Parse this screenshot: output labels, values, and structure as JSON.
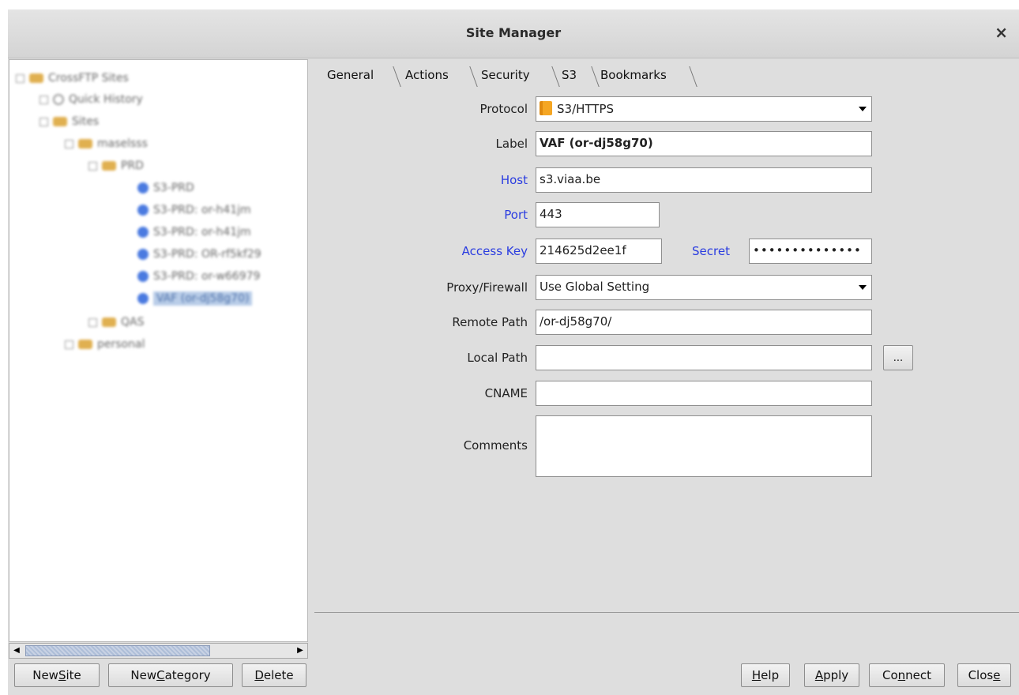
{
  "window": {
    "title": "Site Manager",
    "close_glyph": "×"
  },
  "tree": {
    "nodes": [
      {
        "label": "CrossFTP Sites",
        "icon": "folder-icon"
      },
      {
        "label": "Quick History",
        "icon": "clock-icon"
      },
      {
        "label": "Sites",
        "icon": "folder-icon"
      },
      {
        "label": "maselsss",
        "icon": "folder-icon"
      },
      {
        "label": "PRD",
        "icon": "folder-icon"
      },
      {
        "label": "S3-PRD",
        "icon": "globe-icon"
      },
      {
        "label": "S3-PRD: or-h41jm",
        "icon": "globe-icon"
      },
      {
        "label": "S3-PRD: or-h41jm",
        "icon": "globe-icon"
      },
      {
        "label": "S3-PRD: OR-rf5kf29",
        "icon": "globe-icon"
      },
      {
        "label": "S3-PRD: or-w66979",
        "icon": "globe-icon"
      },
      {
        "label": "VAF (or-dj58g70)",
        "icon": "globe-icon",
        "selected": true
      },
      {
        "label": "QAS",
        "icon": "folder-icon"
      },
      {
        "label": "personal",
        "icon": "folder-icon"
      }
    ]
  },
  "left_buttons": {
    "new_site": {
      "pre": "New ",
      "u": "S",
      "post": "ite"
    },
    "new_category": {
      "pre": "New ",
      "u": "C",
      "post": "ategory"
    },
    "delete": {
      "pre": "",
      "u": "D",
      "post": "elete"
    }
  },
  "tabs": [
    "General",
    "Actions",
    "Security",
    "S3",
    "Bookmarks"
  ],
  "form": {
    "protocol_label": "Protocol",
    "protocol_value": "S3/HTTPS",
    "label_label": "Label",
    "label_value": "VAF (or-dj58g70)",
    "host_label": "Host",
    "host_value": "s3.viaa.be",
    "port_label": "Port",
    "port_value": "443",
    "access_key_label": "Access Key",
    "access_key_value": "214625d2ee1f",
    "secret_label": "Secret",
    "secret_value": "••••••••••••••",
    "proxy_label": "Proxy/Firewall",
    "proxy_value": "Use Global Setting",
    "remote_path_label": "Remote Path",
    "remote_path_value": "/or-dj58g70/",
    "local_path_label": "Local Path",
    "local_path_value": "",
    "browse_label": "...",
    "cname_label": "CNAME",
    "cname_value": "",
    "comments_label": "Comments",
    "comments_value": ""
  },
  "right_buttons": {
    "help": {
      "pre": "",
      "u": "H",
      "post": "elp"
    },
    "apply": {
      "pre": "",
      "u": "A",
      "post": "pply"
    },
    "connect": {
      "pre": "Co",
      "u": "n",
      "post": "nect"
    },
    "close": {
      "pre": "Clos",
      "u": "e",
      "post": ""
    }
  },
  "colors": {
    "link_label": "#2b3de0",
    "selection": "#b9cde8",
    "protocol_icon": "#f5a623"
  }
}
